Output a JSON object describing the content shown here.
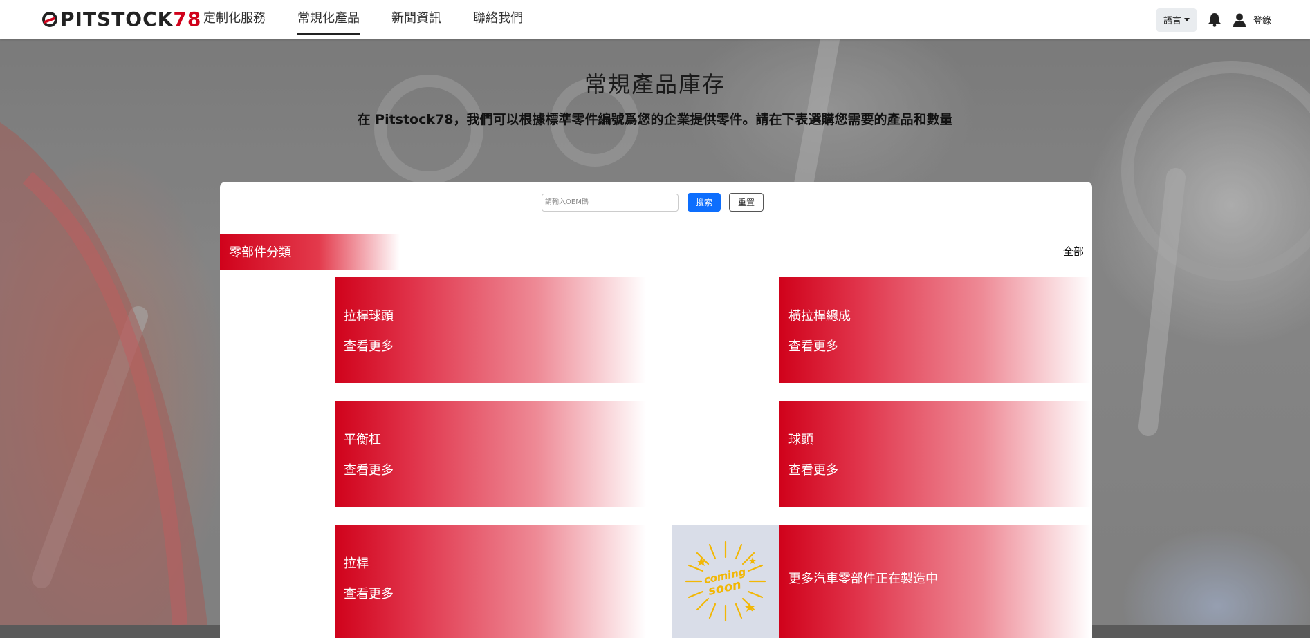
{
  "header": {
    "logo_text": "PITSTOCK",
    "logo_num": "78",
    "nav": [
      {
        "label": "定制化服務",
        "active": false
      },
      {
        "label": "常規化產品",
        "active": true
      },
      {
        "label": "新聞資訊",
        "active": false
      },
      {
        "label": "聯絡我們",
        "active": false
      }
    ],
    "language_label": "語言",
    "login_label": "登錄"
  },
  "hero": {
    "title": "常規產品庫存",
    "subtitle": "在 Pitstock78，我們可以根據標準零件編號爲您的企業提供零件。請在下表選購您需要的產品和數量"
  },
  "search": {
    "placeholder": "請輸入OEM碼",
    "value": "",
    "search_label": "搜索",
    "reset_label": "重置"
  },
  "categories": {
    "title": "零部件分類",
    "all_label": "全部",
    "items": [
      {
        "name": "拉桿球頭",
        "more": "查看更多"
      },
      {
        "name": "橫拉桿總成",
        "more": "查看更多"
      },
      {
        "name": "平衡杠",
        "more": "查看更多"
      },
      {
        "name": "球頭",
        "more": "查看更多"
      },
      {
        "name": "拉桿",
        "more": "查看更多"
      }
    ],
    "coming_soon_text": "更多汽車零部件正在製造中",
    "coming_soon_image_text": [
      "coming",
      "soon"
    ]
  },
  "colors": {
    "brand_red": "#d0021b",
    "primary_blue": "#0d6efd"
  }
}
